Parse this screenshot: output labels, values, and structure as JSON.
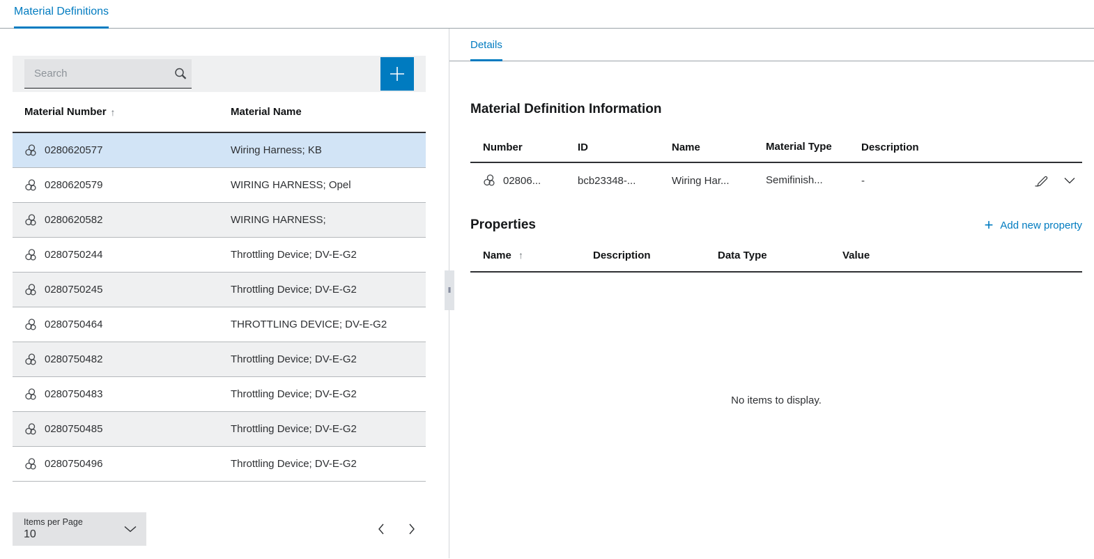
{
  "header": {
    "tab": "Material Definitions"
  },
  "left_panel": {
    "search_placeholder": "Search",
    "table": {
      "columns": [
        "Material Number",
        "Material Name"
      ],
      "sort_indicator": "↑",
      "rows": [
        {
          "number": "0280620577",
          "name": "Wiring Harness; KB",
          "selected": true
        },
        {
          "number": "0280620579",
          "name": "WIRING HARNESS; Opel",
          "selected": false
        },
        {
          "number": "0280620582",
          "name": "WIRING HARNESS;",
          "selected": false
        },
        {
          "number": "0280750244",
          "name": "Throttling Device; DV-E-G2",
          "selected": false
        },
        {
          "number": "0280750245",
          "name": "Throttling Device; DV-E-G2",
          "selected": false
        },
        {
          "number": "0280750464",
          "name": "THROTTLING DEVICE; DV-E-G2",
          "selected": false
        },
        {
          "number": "0280750482",
          "name": "Throttling Device; DV-E-G2",
          "selected": false
        },
        {
          "number": "0280750483",
          "name": "Throttling Device; DV-E-G2",
          "selected": false
        },
        {
          "number": "0280750485",
          "name": "Throttling Device; DV-E-G2",
          "selected": false
        },
        {
          "number": "0280750496",
          "name": "Throttling Device; DV-E-G2",
          "selected": false
        }
      ]
    },
    "pagination": {
      "items_per_page_label": "Items per Page",
      "items_per_page_value": "10"
    }
  },
  "right_panel": {
    "tab": "Details",
    "info_section": {
      "title": "Material Definition Information",
      "columns": {
        "number": "Number",
        "id": "ID",
        "name": "Name",
        "material_type": "Material Type",
        "description": "Description"
      },
      "row": {
        "number": "02806...",
        "id": "bcb23348-...",
        "name": "Wiring Har...",
        "material_type": "Semifinish...",
        "description": "-"
      }
    },
    "properties_section": {
      "title": "Properties",
      "add_link": "Add new property",
      "add_plus": "+",
      "columns": {
        "name": "Name",
        "description": "Description",
        "data_type": "Data Type",
        "value": "Value"
      },
      "sort_indicator": "↑",
      "empty_message": "No items to display."
    }
  },
  "colors": {
    "accent": "#007bc0",
    "selected_row": "#d2e4f6",
    "striped_row": "#eff0f1"
  }
}
